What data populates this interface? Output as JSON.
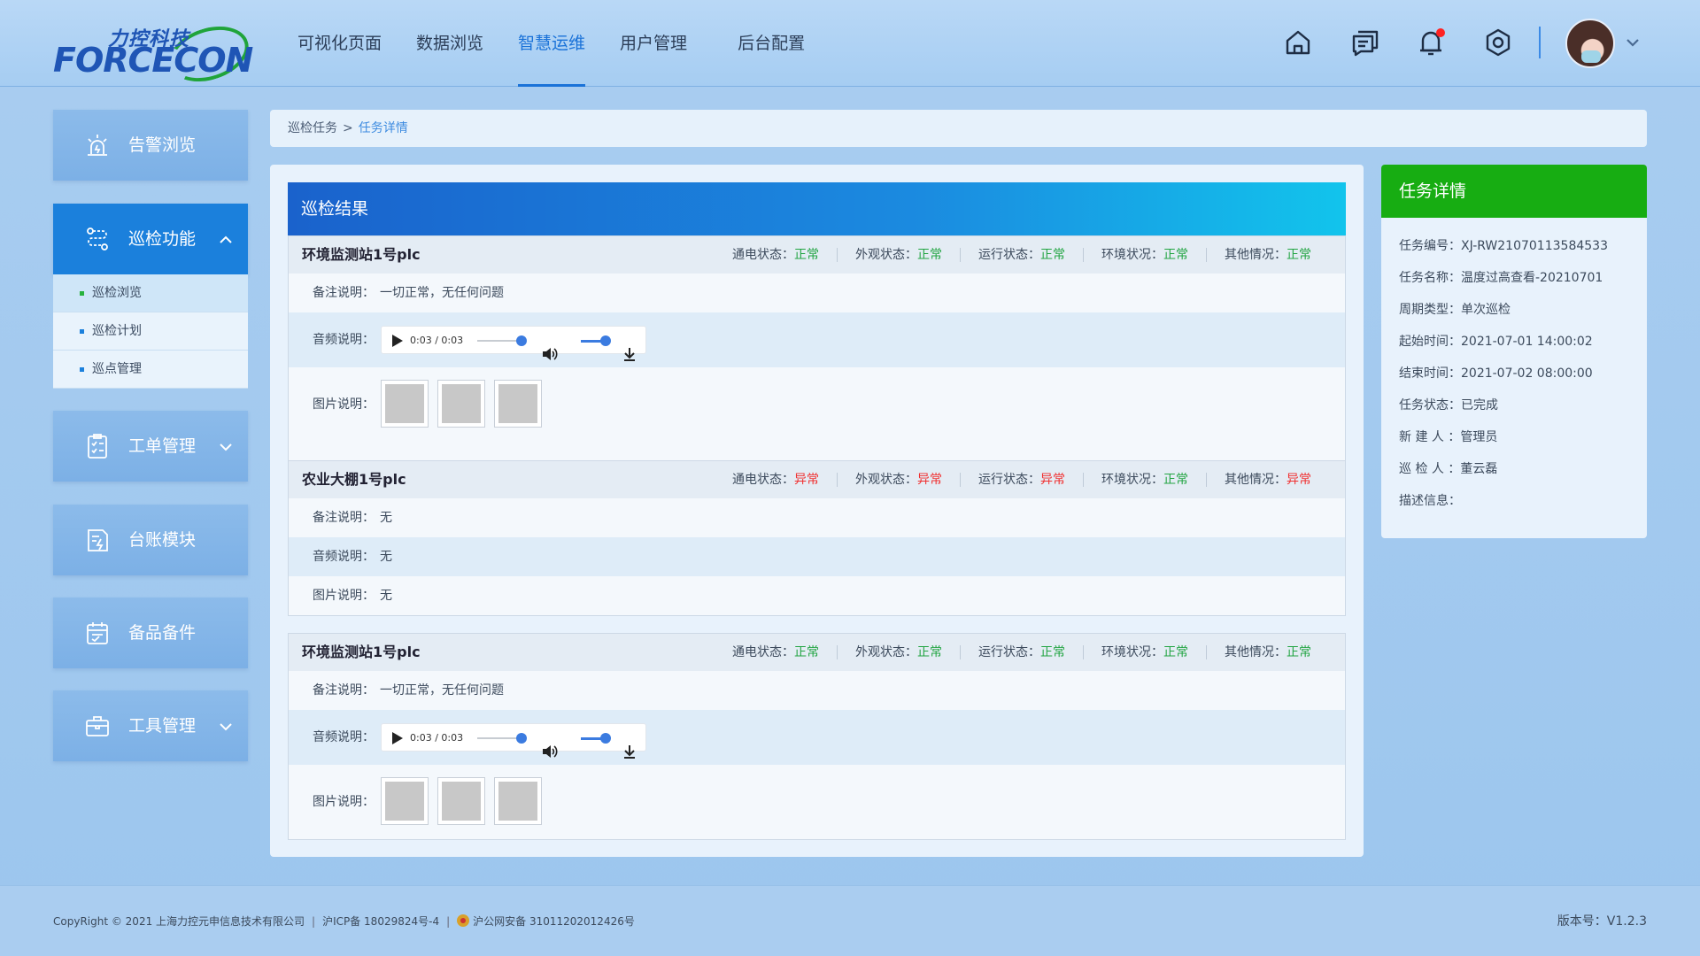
{
  "logo": {
    "cn": "力控科技",
    "en": "FORCECON"
  },
  "nav": {
    "items": [
      {
        "label": "可视化页面",
        "active": false
      },
      {
        "label": "数据浏览",
        "active": false
      },
      {
        "label": "智慧运维",
        "active": true
      },
      {
        "label": "用户管理",
        "active": false
      },
      {
        "label": "后台配置",
        "active": false
      }
    ]
  },
  "header_icons": [
    "home-icon",
    "message-icon",
    "bell-icon",
    "settings-icon"
  ],
  "colors": {
    "accent": "#1a72d8",
    "sidebar_open": "#1b80dc",
    "status_ok": "#23a543",
    "status_bad": "#f03030",
    "detail_header": "#17ad12"
  },
  "sidebar": {
    "items": [
      {
        "label": "告警浏览",
        "icon": "alarm-light-icon"
      },
      {
        "label": "巡检功能",
        "icon": "route-icon",
        "open": true
      },
      {
        "label": "工单管理",
        "icon": "clipboard-checklist-icon"
      },
      {
        "label": "台账模块",
        "icon": "ledger-icon"
      },
      {
        "label": "备品备件",
        "icon": "calendar-check-icon"
      },
      {
        "label": "工具管理",
        "icon": "toolbox-icon"
      }
    ],
    "submenu": [
      {
        "label": "巡检浏览",
        "active": true
      },
      {
        "label": "巡检计划",
        "active": false
      },
      {
        "label": "巡点管理",
        "active": false
      }
    ]
  },
  "breadcrumb": {
    "parent": "巡检任务",
    "separator": ">",
    "current": "任务详情"
  },
  "results": {
    "title": "巡检结果",
    "labels": {
      "remark": "备注说明：",
      "audio": "音频说明：",
      "image": "图片说明："
    },
    "cards": [
      {
        "name": "环境监测站1号plc",
        "statuses": [
          {
            "label": "通电状态：",
            "value": "正常",
            "ok": true
          },
          {
            "label": "外观状态：",
            "value": "正常",
            "ok": true
          },
          {
            "label": "运行状态：",
            "value": "正常",
            "ok": true
          },
          {
            "label": "环境状况：",
            "value": "正常",
            "ok": true
          },
          {
            "label": "其他情况：",
            "value": "正常",
            "ok": true
          }
        ],
        "remark": "一切正常，无任何问题",
        "audio_time": "0:03 / 0:03",
        "audio_progress": 1.0,
        "image_count": 3
      },
      {
        "name": "农业大棚1号plc",
        "statuses": [
          {
            "label": "通电状态：",
            "value": "异常",
            "ok": false
          },
          {
            "label": "外观状态：",
            "value": "异常",
            "ok": false
          },
          {
            "label": "运行状态：",
            "value": "异常",
            "ok": false
          },
          {
            "label": "环境状况：",
            "value": "正常",
            "ok": true
          },
          {
            "label": "其他情况：",
            "value": "异常",
            "ok": false
          }
        ],
        "remark": "无",
        "audio_text": "无",
        "image_text": "无"
      },
      {
        "name": "环境监测站1号plc",
        "statuses": [
          {
            "label": "通电状态：",
            "value": "正常",
            "ok": true
          },
          {
            "label": "外观状态：",
            "value": "正常",
            "ok": true
          },
          {
            "label": "运行状态：",
            "value": "正常",
            "ok": true
          },
          {
            "label": "环境状况：",
            "value": "正常",
            "ok": true
          },
          {
            "label": "其他情况：",
            "value": "正常",
            "ok": true
          }
        ],
        "remark": "一切正常，无任何问题",
        "audio_time": "0:03 / 0:03",
        "audio_progress": 1.0,
        "image_count": 3
      }
    ]
  },
  "detail": {
    "title": "任务详情",
    "rows": [
      "任务编号：XJ-RW21070113584533",
      "任务名称：温度过高查看-20210701",
      "周期类型：单次巡检",
      "起始时间：2021-07-01 14:00:02",
      "结束时间：2021-07-02 08:00:00",
      "任务状态：已完成",
      "新 建 人 ：管理员",
      "巡 检 人 ：董云磊",
      "描述信息："
    ]
  },
  "footer": {
    "copyright": "CopyRight © 2021 上海力控元申信息技术有限公司",
    "icp": "沪ICP备 18029824号-4",
    "police": "沪公网安备 31011202012426号",
    "version": "版本号：V1.2.3"
  }
}
